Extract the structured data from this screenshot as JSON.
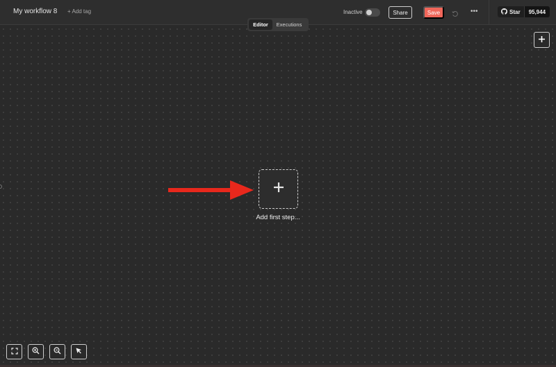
{
  "header": {
    "workflow_name": "My workflow 8",
    "add_tag_label": "+ Add tag",
    "active_toggle": {
      "label": "Inactive",
      "active": false
    },
    "share_label": "Share",
    "save_label": "Save",
    "github": {
      "star_label": "Star",
      "star_count": "95,944"
    }
  },
  "tabs": [
    {
      "label": "Editor",
      "active": true
    },
    {
      "label": "Executions",
      "active": false
    }
  ],
  "canvas": {
    "first_step_label": "Add first step..."
  },
  "colors": {
    "save_button": "#f0665a",
    "arrow": "#e8281c",
    "canvas_bg": "#2a2a2a"
  },
  "icons": {
    "add_node": "plus-icon",
    "first_step": "plus-icon",
    "history": "history-icon",
    "more": "ellipsis-icon",
    "github": "github-icon",
    "controls": [
      "fit-view-icon",
      "zoom-in-icon",
      "zoom-out-icon",
      "pointer-icon"
    ]
  }
}
